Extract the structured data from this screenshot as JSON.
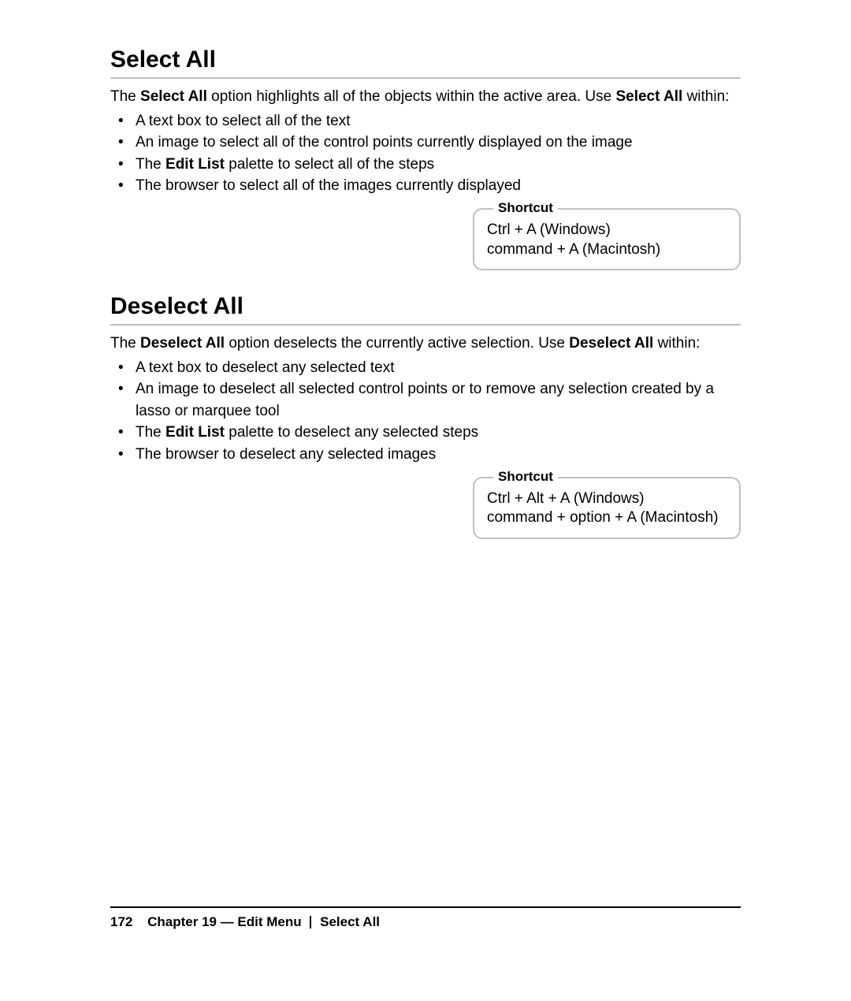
{
  "sections": [
    {
      "heading": "Select All",
      "intro_parts": [
        {
          "t": "The "
        },
        {
          "t": "Select All",
          "bold": true
        },
        {
          "t": " option highlights all of the objects within the active area. Use "
        },
        {
          "t": "Select All",
          "bold": true
        },
        {
          "t": " within:"
        }
      ],
      "bullets": [
        [
          {
            "t": "A text box to select all of the text"
          }
        ],
        [
          {
            "t": "An image to select all of the control points currently displayed on the image"
          }
        ],
        [
          {
            "t": "The "
          },
          {
            "t": "Edit List",
            "bold": true
          },
          {
            "t": " palette to select all of the steps"
          }
        ],
        [
          {
            "t": "The browser to select all of the images currently displayed"
          }
        ]
      ],
      "shortcut": {
        "label": "Shortcut",
        "lines": [
          "Ctrl + A (Windows)",
          "command + A (Macintosh)"
        ]
      }
    },
    {
      "heading": "Deselect All",
      "intro_parts": [
        {
          "t": "The "
        },
        {
          "t": "Deselect All",
          "bold": true
        },
        {
          "t": " option deselects the currently active selection. Use "
        },
        {
          "t": "Deselect All",
          "bold": true
        },
        {
          "t": " within:"
        }
      ],
      "bullets": [
        [
          {
            "t": "A text box to deselect any selected text"
          }
        ],
        [
          {
            "t": "An image to deselect all selected control points or to remove any selection created by a lasso or marquee tool"
          }
        ],
        [
          {
            "t": "The "
          },
          {
            "t": "Edit List",
            "bold": true
          },
          {
            "t": " palette to deselect any selected steps"
          }
        ],
        [
          {
            "t": "The browser to deselect any selected images"
          }
        ]
      ],
      "shortcut": {
        "label": "Shortcut",
        "lines": [
          "Ctrl + Alt + A (Windows)",
          "command + option + A (Macintosh)"
        ]
      }
    }
  ],
  "footer": {
    "page_number": "172",
    "chapter": "Chapter 19 — Edit Menu",
    "topic": "Select All"
  }
}
